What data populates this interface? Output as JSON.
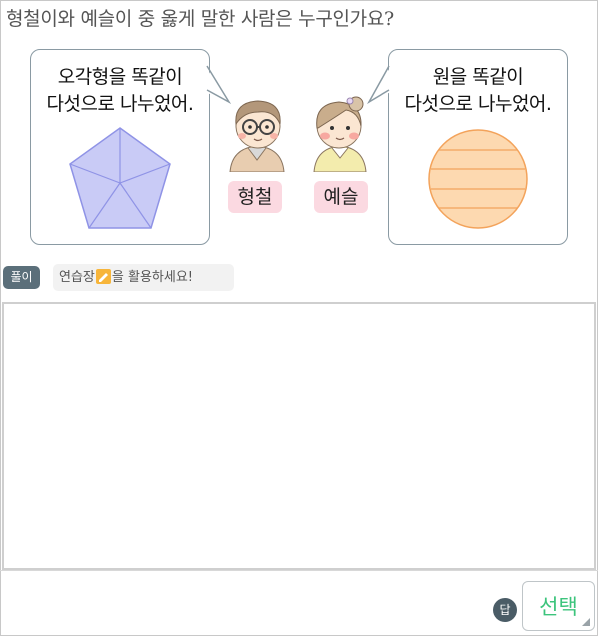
{
  "question": "형철이와 예슬이 중 옳게 말한 사람은 누구인가요?",
  "bubbles": {
    "left": {
      "line1": "오각형을 똑같이",
      "line2": "다섯으로 나누었어."
    },
    "right": {
      "line1": "원을 똑같이",
      "line2": "다섯으로 나누었어."
    }
  },
  "names": {
    "boy": "형철",
    "girl": "예슬"
  },
  "solve": {
    "badge": "풀이",
    "hint_before": "연습장",
    "hint_after": "을 활용하세요!"
  },
  "answer": {
    "badge": "답",
    "select_label": "선택"
  },
  "colors": {
    "pentagon_fill": "#c9cbf6",
    "pentagon_stroke": "#8f93e6",
    "circle_fill": "#fdd9b0",
    "circle_stroke": "#f3a35b",
    "name_badge": "#fbd9e1",
    "select_text": "#3cc47c"
  }
}
